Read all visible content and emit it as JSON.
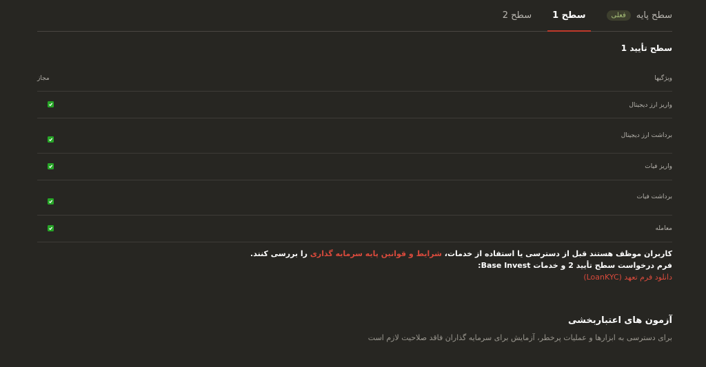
{
  "tabs": [
    {
      "label": "سطح پایه",
      "badge": "فعلی"
    },
    {
      "label": "سطح 1"
    },
    {
      "label": "سطح 2"
    }
  ],
  "section_title": "سطح تأیید 1",
  "table": {
    "header_feature": "ویژگیها",
    "header_allowed": "مجاز",
    "rows": [
      {
        "label": "واریز ارز دیجیتال",
        "allowed": true
      },
      {
        "label": "برداشت ارز دیجیتال",
        "allowed": true
      },
      {
        "label": "واریز فیات",
        "allowed": true
      },
      {
        "label": "برداشت فیات",
        "allowed": true
      },
      {
        "label": "معامله",
        "allowed": true
      }
    ]
  },
  "notice": {
    "line1_before": "کاربران موظف هستند قبل از دسترسی یا استفاده از خدمات، ",
    "line1_link": "شرایط و قوانین پایه سرمایه گذاری",
    "line1_after": " را بررسی کنند.",
    "line2": "فرم درخواست سطح تأیید 2 و خدمات Base Invest:",
    "line3_link": "دانلود فرم تعهد (LoanKYC)"
  },
  "credit": {
    "title": "آزمون های اعتباربخشی",
    "description": "برای دسترسی به ابزارها و عملیات پرخطر، آزمایش برای سرمایه گذاران فاقد صلاحیت لازم است"
  },
  "colors": {
    "background": "#272622",
    "accent_red": "#d94a3c",
    "check_green": "#27a527"
  }
}
